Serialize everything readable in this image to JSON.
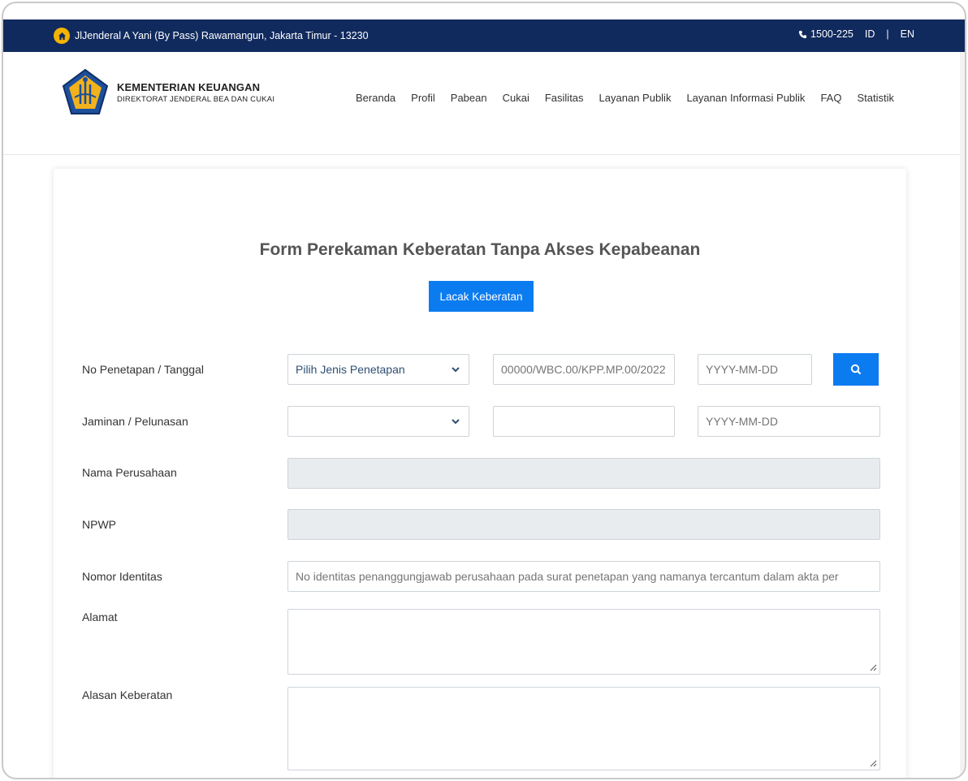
{
  "topbar": {
    "address": "JlJenderal A Yani (By Pass) Rawamangun, Jakarta Timur - 13230",
    "phone": "1500-225",
    "lang_id": "ID",
    "lang_sep": "|",
    "lang_en": "EN"
  },
  "brand": {
    "title": "KEMENTERIAN KEUANGAN",
    "subtitle": "DIREKTORAT JENDERAL BEA DAN CUKAI"
  },
  "nav": [
    "Beranda",
    "Profil",
    "Pabean",
    "Cukai",
    "Fasilitas",
    "Layanan Publik",
    "Layanan Informasi Publik",
    "FAQ",
    "Statistik"
  ],
  "form": {
    "title": "Form Perekaman Keberatan Tanpa Akses Kepabeanan",
    "track_button": "Lacak Keberatan",
    "labels": {
      "penetapan": "No Penetapan / Tanggal",
      "jaminan": "Jaminan / Pelunasan",
      "perusahaan": "Nama Perusahaan",
      "npwp": "NPWP",
      "identitas": "Nomor Identitas",
      "alamat": "Alamat",
      "alasan": "Alasan Keberatan"
    },
    "penetapan_select": "Pilih Jenis Penetapan",
    "penetapan_number_placeholder": "00000/WBC.00/KPP.MP.00/2022",
    "date_placeholder": "YYYY-MM-DD",
    "jaminan_select": "",
    "identitas_placeholder": "No identitas penanggungjawab perusahaan pada surat penetapan yang namanya tercantum dalam akta per"
  },
  "colors": {
    "topbar": "#112a5e",
    "primary": "#0b7bf0",
    "disabled_bg": "#e9ecef"
  }
}
